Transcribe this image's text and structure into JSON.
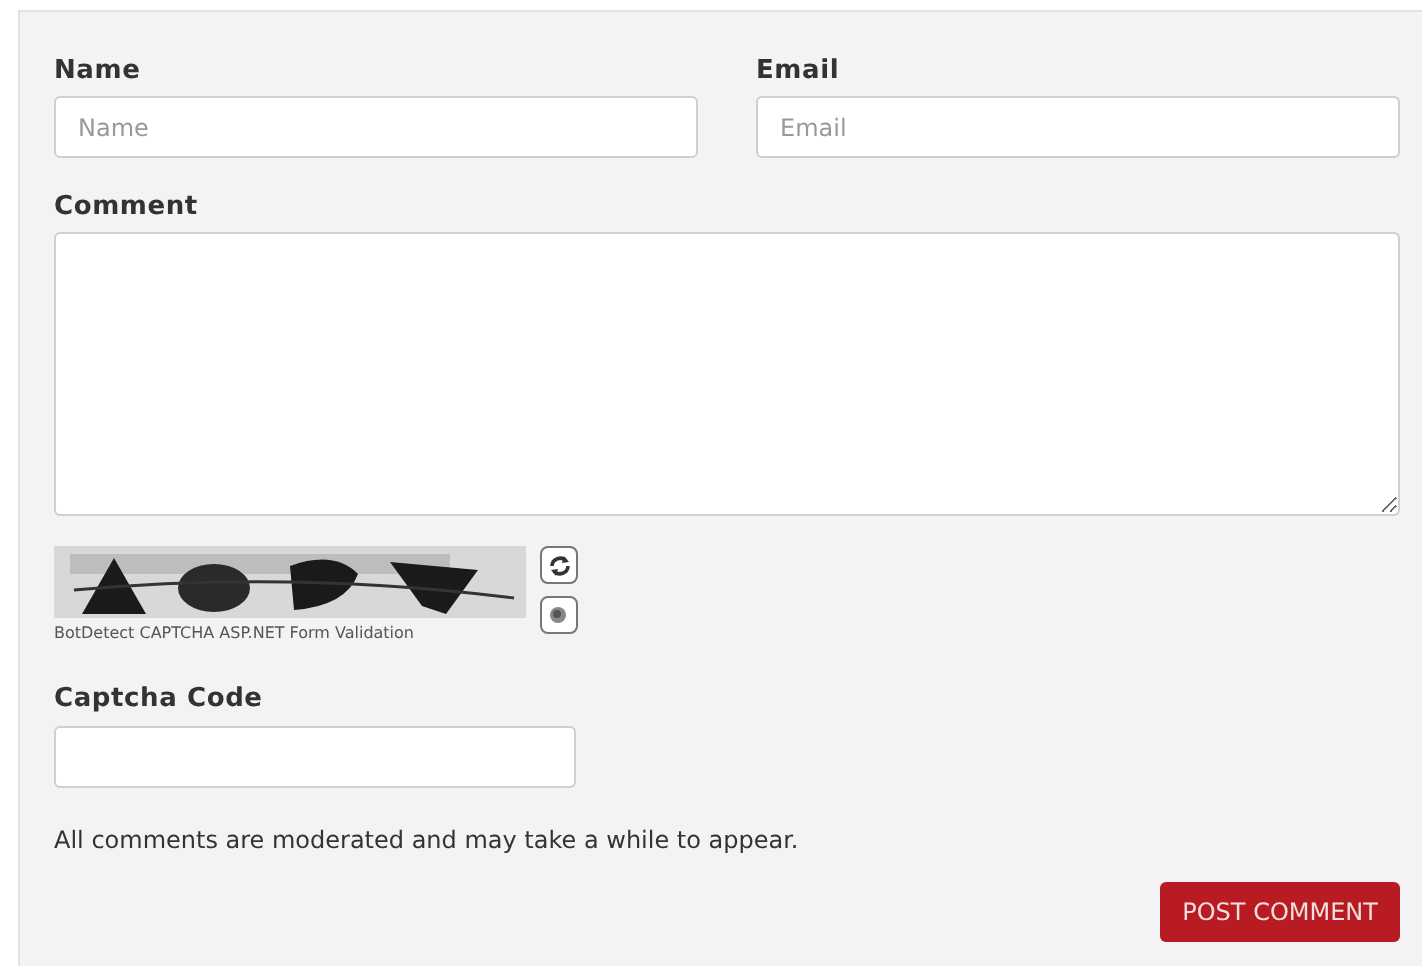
{
  "fields": [
    {
      "label": "Name",
      "placeholder": "Name"
    },
    {
      "label": "Email",
      "placeholder": "Email"
    }
  ],
  "comment": {
    "label": "Comment"
  },
  "captcha": {
    "caption": "BotDetect CAPTCHA ASP.NET Form Validation"
  },
  "captcha_code": {
    "label": "Captcha Code"
  },
  "note": "All comments are moderated and may take a while to appear.",
  "submit": "POST COMMENT"
}
